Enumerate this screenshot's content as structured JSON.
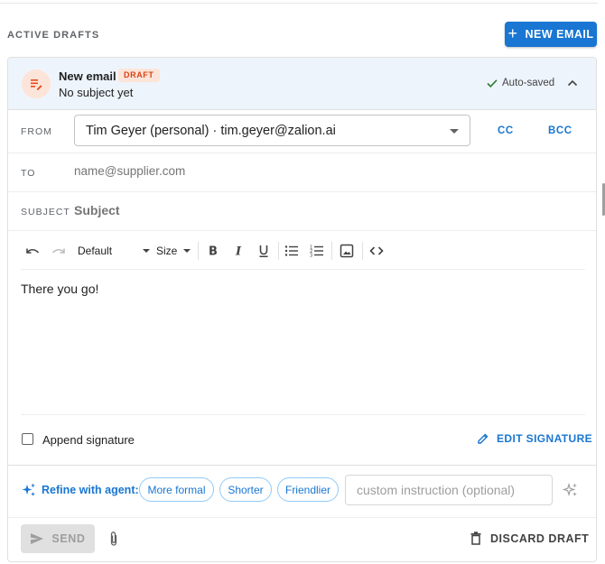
{
  "section": {
    "title": "ACTIVE DRAFTS",
    "new_email_label": "NEW EMAIL"
  },
  "draft": {
    "title": "New email",
    "badge": "DRAFT",
    "subtitle": "No subject yet",
    "autosaved_label": "Auto-saved"
  },
  "from": {
    "label": "FROM",
    "value": "Tim Geyer (personal) · tim.geyer@zalion.ai",
    "cc_label": "CC",
    "bcc_label": "BCC"
  },
  "to": {
    "label": "TO",
    "placeholder": "name@supplier.com",
    "value": ""
  },
  "subject": {
    "label": "SUBJECT",
    "placeholder": "Subject",
    "value": ""
  },
  "toolbar": {
    "font_label": "Default",
    "size_label": "Size"
  },
  "body": {
    "text": "There you go!"
  },
  "signature": {
    "append_label": "Append signature",
    "checked": false,
    "edit_label": "EDIT SIGNATURE"
  },
  "refine": {
    "label": "Refine with agent:",
    "chips": [
      "More formal",
      "Shorter",
      "Friendlier"
    ],
    "custom_placeholder": "custom instruction (optional)"
  },
  "footer": {
    "send_label": "SEND",
    "discard_label": "DISCARD DRAFT"
  },
  "colors": {
    "accent": "#1976d2",
    "draft_badge_bg": "#fde4d8",
    "draft_badge_text": "#d84315",
    "header_bg": "#eef4fc"
  }
}
